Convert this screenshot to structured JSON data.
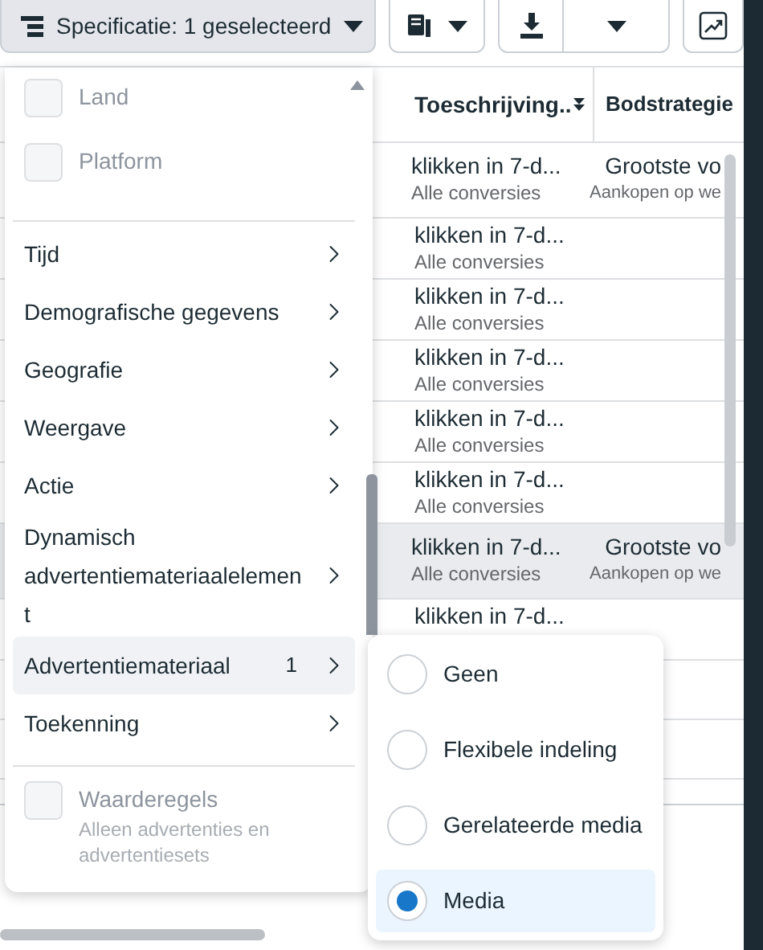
{
  "toolbar": {
    "breakdown_button": "Specificatie: 1 geselecteerd"
  },
  "table": {
    "columns": [
      "Toeschrijving..",
      "Bodstrategie"
    ],
    "rows": [
      {
        "highlighted": false,
        "cells": [
          {
            "text": "klikken in 7-d...",
            "subtext": "Alle conversies"
          },
          {
            "text": "Grootste vo",
            "subtext": "Aankopen op we"
          }
        ]
      },
      {
        "highlighted": false,
        "cells": [
          {
            "text": "klikken in 7-d...",
            "subtext": "Alle conversies"
          }
        ]
      },
      {
        "highlighted": false,
        "cells": [
          {
            "text": "klikken in 7-d...",
            "subtext": "Alle conversies"
          }
        ]
      },
      {
        "highlighted": false,
        "cells": [
          {
            "text": "klikken in 7-d...",
            "subtext": "Alle conversies"
          }
        ]
      },
      {
        "highlighted": false,
        "cells": [
          {
            "text": "klikken in 7-d...",
            "subtext": "Alle conversies"
          }
        ]
      },
      {
        "highlighted": false,
        "cells": [
          {
            "text": "klikken in 7-d...",
            "subtext": "Alle conversies"
          }
        ]
      },
      {
        "highlighted": true,
        "cells": [
          {
            "text": "klikken in 7-d...",
            "subtext": "Alle conversies"
          },
          {
            "text": "Grootste vo",
            "subtext": "Aankopen op we"
          }
        ]
      },
      {
        "highlighted": false,
        "cells": [
          {
            "text": "klikken in 7-d..."
          }
        ]
      }
    ]
  },
  "menu": {
    "items": [
      {
        "kind": "checkbox",
        "label": "Land",
        "checked": false,
        "disabled": true
      },
      {
        "kind": "checkbox",
        "label": "Platform",
        "checked": false,
        "disabled": true
      },
      {
        "kind": "divider"
      },
      {
        "kind": "submenu",
        "label": "Tijd",
        "selected": false
      },
      {
        "kind": "submenu",
        "label": "Demografische gegevens",
        "selected": false
      },
      {
        "kind": "submenu",
        "label": "Geografie",
        "selected": false
      },
      {
        "kind": "submenu",
        "label": "Weergave",
        "selected": false
      },
      {
        "kind": "submenu",
        "label": "Actie",
        "selected": false
      },
      {
        "kind": "submenu",
        "label": "Dynamisch advertentiemateriaalelement",
        "selected": false
      },
      {
        "kind": "submenu",
        "label": "Advertentiemateriaal",
        "badge": "1",
        "selected": true
      },
      {
        "kind": "submenu",
        "label": "Toekenning",
        "selected": false
      },
      {
        "kind": "divider"
      },
      {
        "kind": "checkbox",
        "label": "Waarderegels",
        "description": "Alleen advertenties en advertentiesets",
        "checked": false,
        "disabled": true
      }
    ]
  },
  "submenu": {
    "options": [
      {
        "label": "Geen",
        "selected": false
      },
      {
        "label": "Flexibele indeling",
        "selected": false
      },
      {
        "label": "Gerelateerde media",
        "selected": false
      },
      {
        "label": "Media",
        "selected": true
      }
    ]
  }
}
